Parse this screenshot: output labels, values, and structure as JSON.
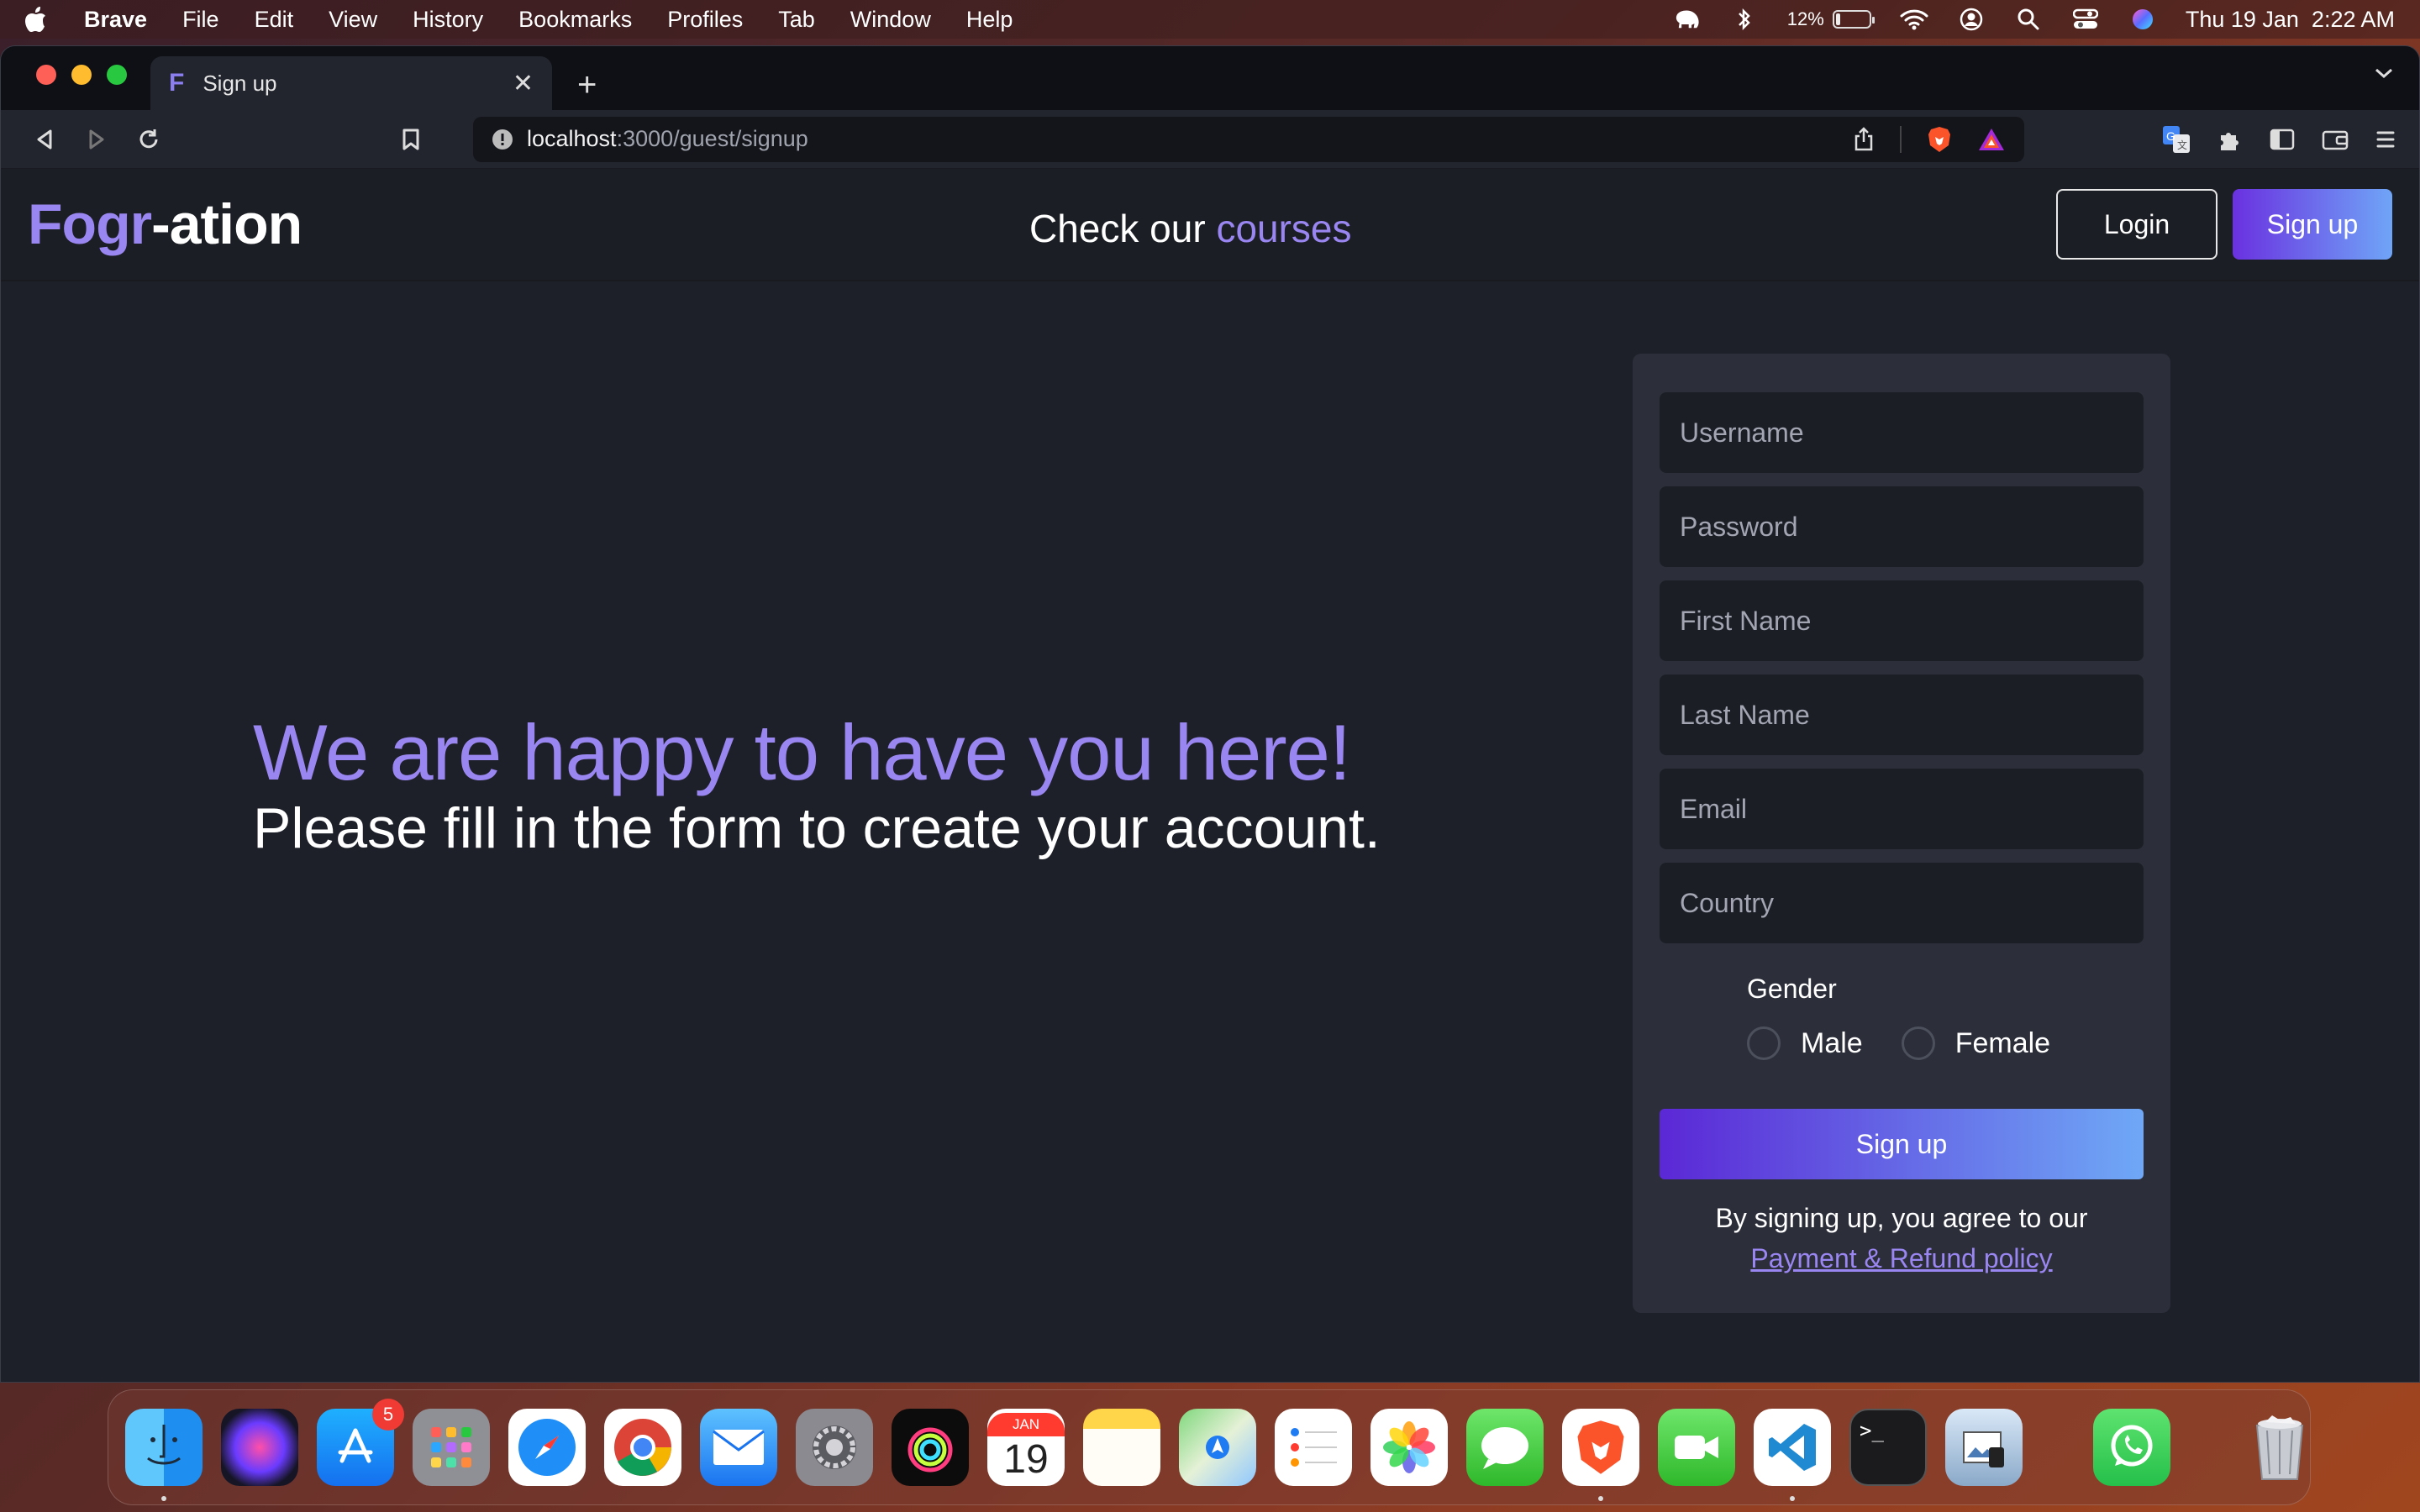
{
  "menubar": {
    "app": "Brave",
    "items": [
      "File",
      "Edit",
      "View",
      "History",
      "Bookmarks",
      "Profiles",
      "Tab",
      "Window",
      "Help"
    ],
    "battery": "12%",
    "datetime": "Thu 19 Jan  2:22 AM"
  },
  "browser": {
    "tab_title": "Sign up",
    "tab_favicon": "F",
    "url_host": "localhost",
    "url_path": ":3000/guest/signup"
  },
  "site": {
    "logo_a": "Fogr",
    "logo_b": "-ation",
    "nav_text": "Check our ",
    "nav_link": "courses",
    "login_label": "Login",
    "signup_label": "Sign up"
  },
  "hero": {
    "headline": "We are happy to have you here!",
    "subline": "Please fill in the form to create your account."
  },
  "form": {
    "username_placeholder": "Username",
    "password_placeholder": "Password",
    "firstname_placeholder": "First Name",
    "lastname_placeholder": "Last Name",
    "email_placeholder": "Email",
    "country_placeholder": "Country",
    "gender_label": "Gender",
    "gender_male": "Male",
    "gender_female": "Female",
    "submit_label": "Sign up",
    "terms_text": "By signing up, you agree to our",
    "terms_link": "Payment & Refund policy"
  },
  "dock": {
    "appstore_badge": "5",
    "calendar_month": "JAN",
    "calendar_day": "19"
  },
  "colors": {
    "accent": "#9a86f0",
    "page_bg": "#1e2029",
    "card_bg": "#2c2e3a",
    "gradient_start": "#5b28d6",
    "gradient_end": "#6fa8f6"
  }
}
